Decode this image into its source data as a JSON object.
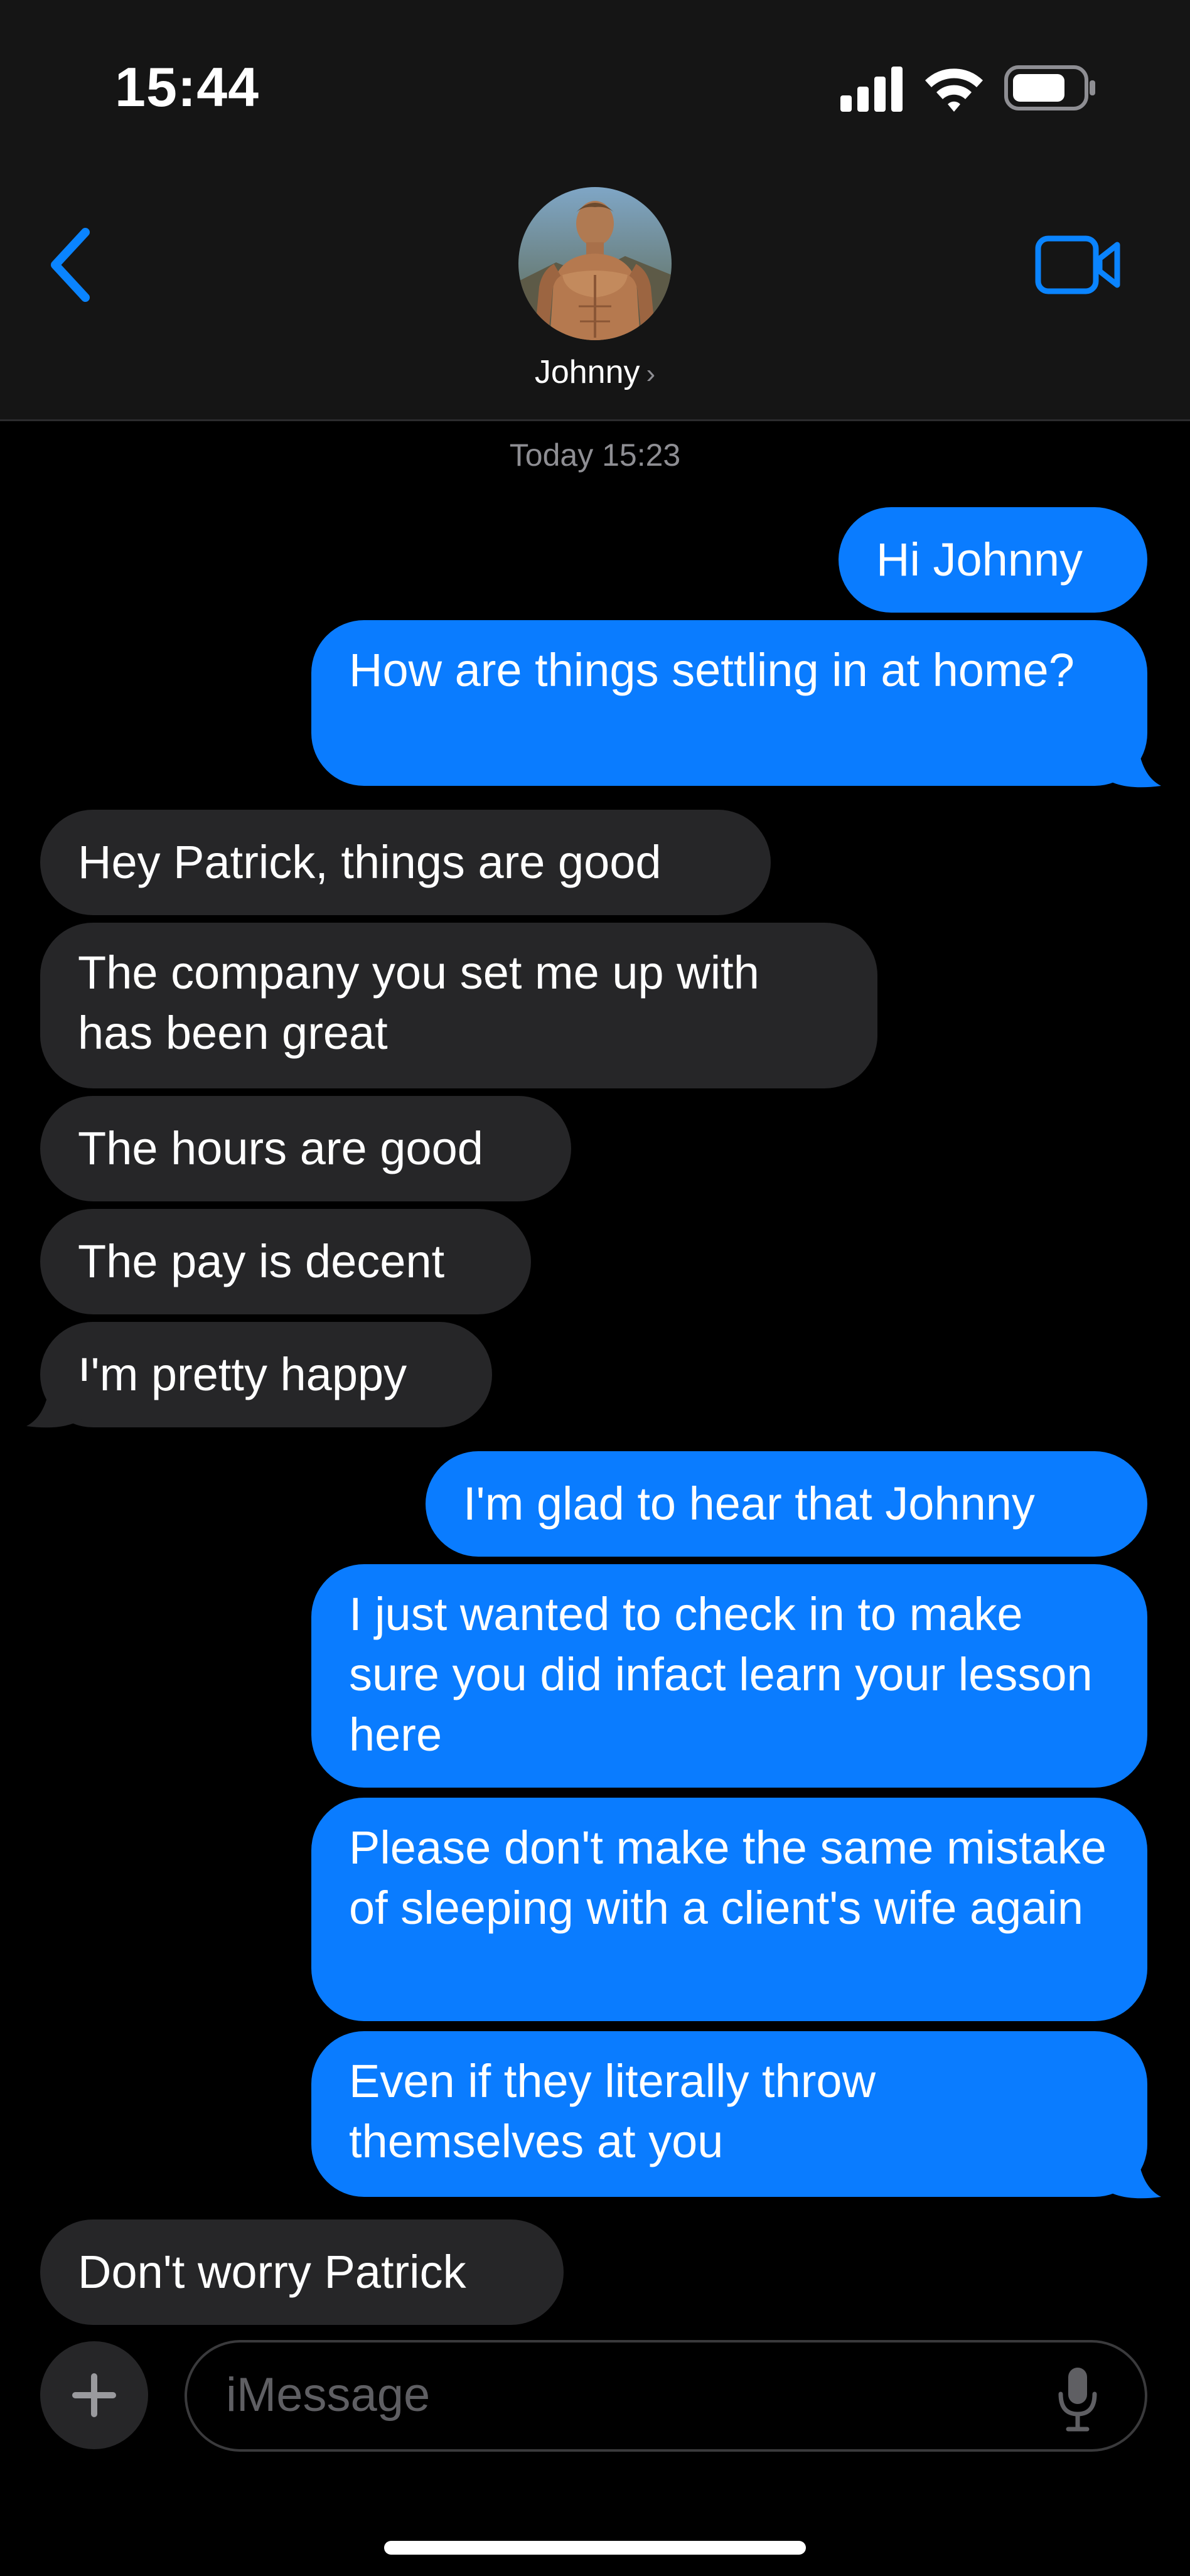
{
  "status_bar": {
    "time": "15:44"
  },
  "header": {
    "contact_name": "Johnny",
    "chevron": "›",
    "back_icon": "chevron-left-icon",
    "video_icon": "video-camera-icon"
  },
  "thread": {
    "timestamp": "Today 15:23",
    "messages": [
      {
        "from": "me",
        "text": "Hi Johnny"
      },
      {
        "from": "me",
        "text": "How are things settling in at home?"
      },
      {
        "from": "them",
        "text": "Hey Patrick, things are good"
      },
      {
        "from": "them",
        "text": "The company you set me up with has been great"
      },
      {
        "from": "them",
        "text": "The hours are good"
      },
      {
        "from": "them",
        "text": "The pay is decent"
      },
      {
        "from": "them",
        "text": "I'm pretty happy"
      },
      {
        "from": "me",
        "text": "I'm glad to hear that Johnny"
      },
      {
        "from": "me",
        "text": "I just wanted to check in to make sure you did infact learn your lesson here"
      },
      {
        "from": "me",
        "text": "Please don't make the same mistake of sleeping with a client's wife again"
      },
      {
        "from": "me",
        "text": "Even if they literally throw themselves at you"
      },
      {
        "from": "them",
        "text": "Don't worry Patrick"
      }
    ]
  },
  "composer": {
    "placeholder": "iMessage",
    "plus_label": "+"
  },
  "colors": {
    "sent": "#0a7cff",
    "received": "#262628",
    "accent": "#0a84ff",
    "background": "#000000"
  }
}
